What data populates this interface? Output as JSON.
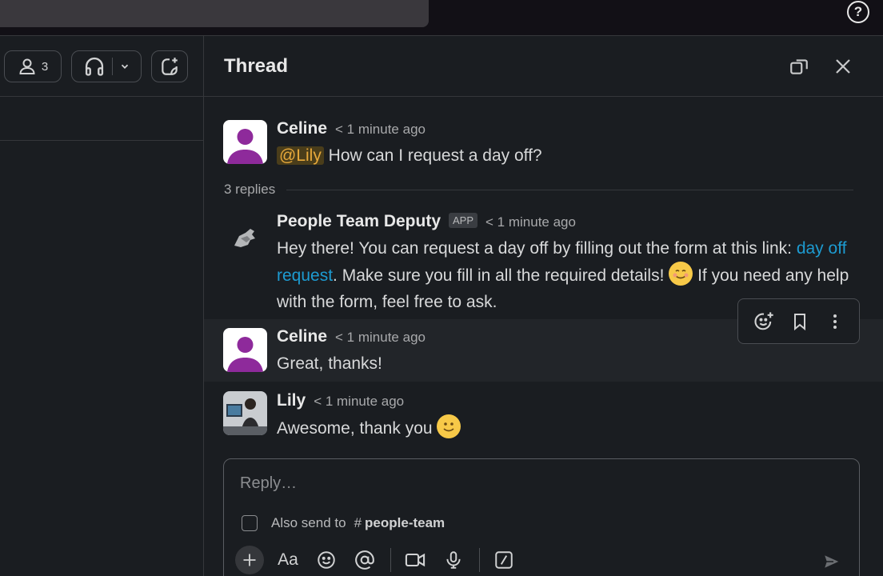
{
  "help": {
    "label": "?"
  },
  "channel_header": {
    "member_count": "3"
  },
  "thread": {
    "title": "Thread",
    "replies_label": "3 replies",
    "messages": [
      {
        "author": "Celine",
        "time": "< 1 minute ago",
        "mention": "@Lily",
        "text": " How can I request a day off?"
      },
      {
        "author": "People Team Deputy",
        "badge": "APP",
        "time": "< 1 minute ago",
        "text_before_link": "Hey there! You can request a day off by filling out the form at this link: ",
        "link_text": "day off request",
        "text_after_link": ". Make sure you fill in all the required details! ",
        "text_end": " If you need any help with the form, feel free to ask."
      },
      {
        "author": "Celine",
        "time": "< 1 minute ago",
        "text": "Great, thanks!"
      },
      {
        "author": "Lily",
        "time": "< 1 minute ago",
        "text": "Awesome, thank you "
      }
    ]
  },
  "composer": {
    "placeholder": "Reply…",
    "also_send_prefix": "Also send to",
    "channel_hash": "#",
    "channel_name": "people-team",
    "format_label": "Aa"
  },
  "colors": {
    "link": "#1d9bd1",
    "mention": "#e8a93b",
    "avatar_purple": "#8e2a9b"
  }
}
